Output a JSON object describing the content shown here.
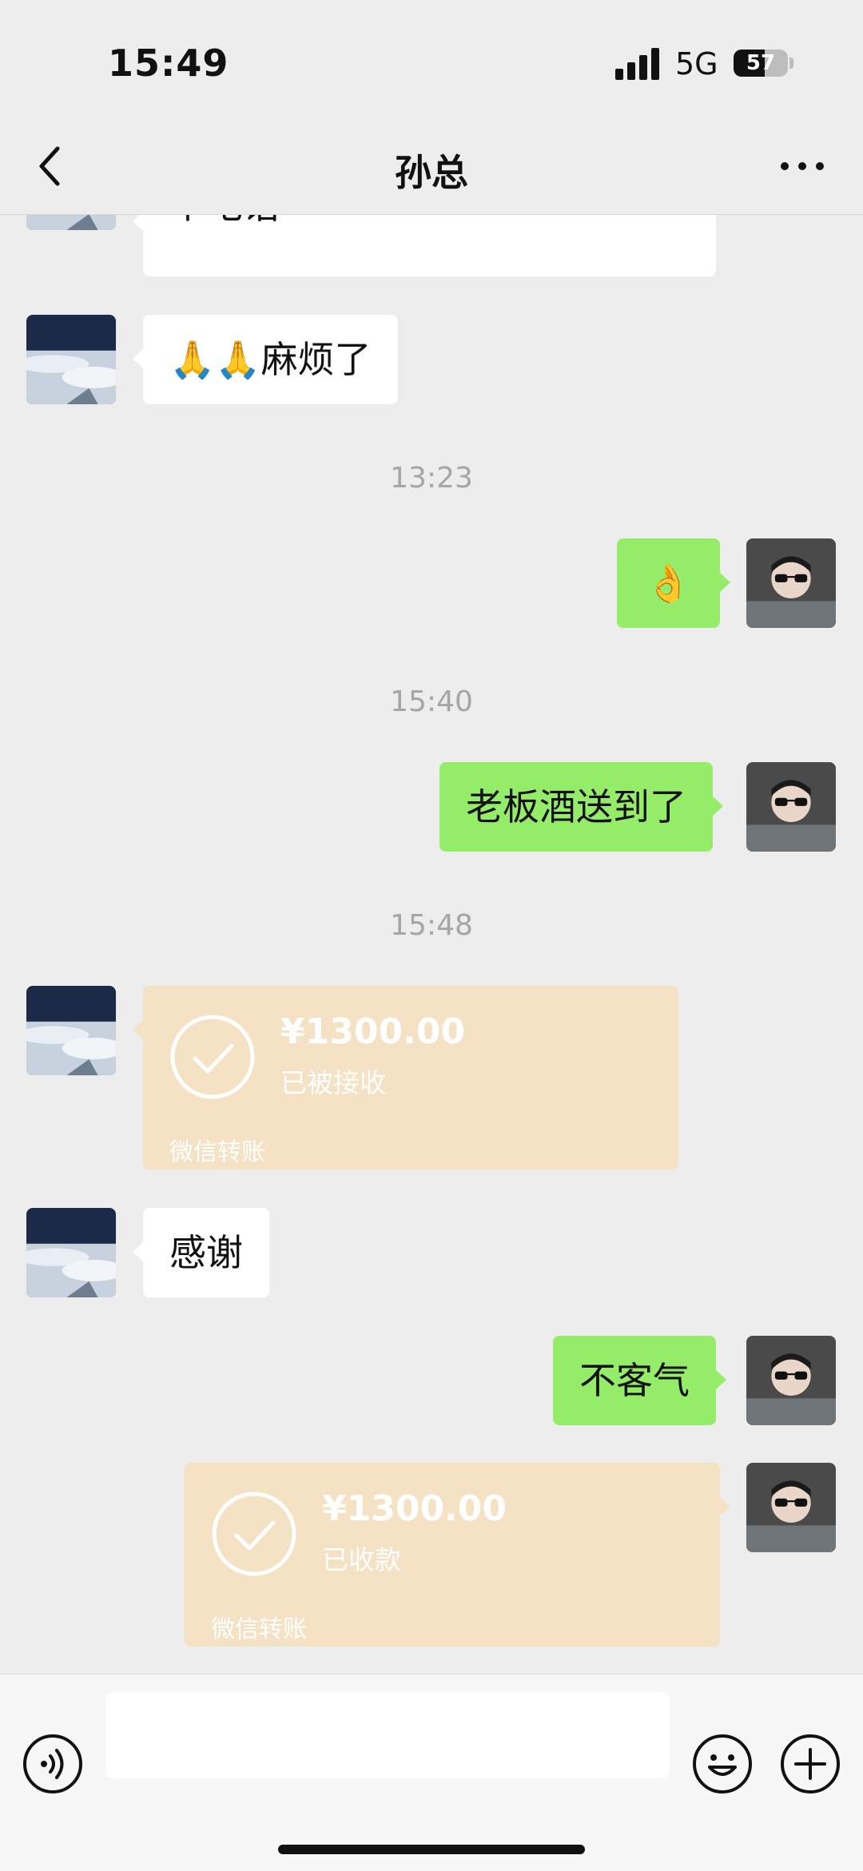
{
  "status_bar": {
    "time": "15:49",
    "network": "5G",
    "battery_level": "57"
  },
  "nav": {
    "title": "孙总"
  },
  "messages": [
    {
      "type": "text",
      "side": "left",
      "text": "个电话"
    },
    {
      "type": "text",
      "side": "left",
      "text": "🙏🙏麻烦了"
    },
    {
      "type": "time",
      "text": "13:23"
    },
    {
      "type": "text",
      "side": "right",
      "text": "👌"
    },
    {
      "type": "time",
      "text": "15:40"
    },
    {
      "type": "text",
      "side": "right",
      "text": "老板酒送到了"
    },
    {
      "type": "time",
      "text": "15:48"
    },
    {
      "type": "transfer",
      "side": "left",
      "amount": "¥1300.00",
      "status": "已被接收",
      "footer": "微信转账"
    },
    {
      "type": "text",
      "side": "left",
      "text": "感谢"
    },
    {
      "type": "text",
      "side": "right",
      "text": "不客气"
    },
    {
      "type": "transfer",
      "side": "right",
      "amount": "¥1300.00",
      "status": "已收款",
      "footer": "微信转账"
    }
  ],
  "input": {
    "value": "",
    "placeholder": ""
  },
  "icons": {
    "back": "chevron-left-icon",
    "more": "more-dots-icon",
    "voice": "voice-icon",
    "emoji": "emoji-icon",
    "plus": "plus-icon",
    "check": "check-circle-icon"
  },
  "colors": {
    "chat_background": "#ededed",
    "own_bubble": "#95ec69",
    "other_bubble": "#ffffff",
    "transfer_card": "#f5e2c4",
    "timestamp_text": "#a5a5a5"
  }
}
